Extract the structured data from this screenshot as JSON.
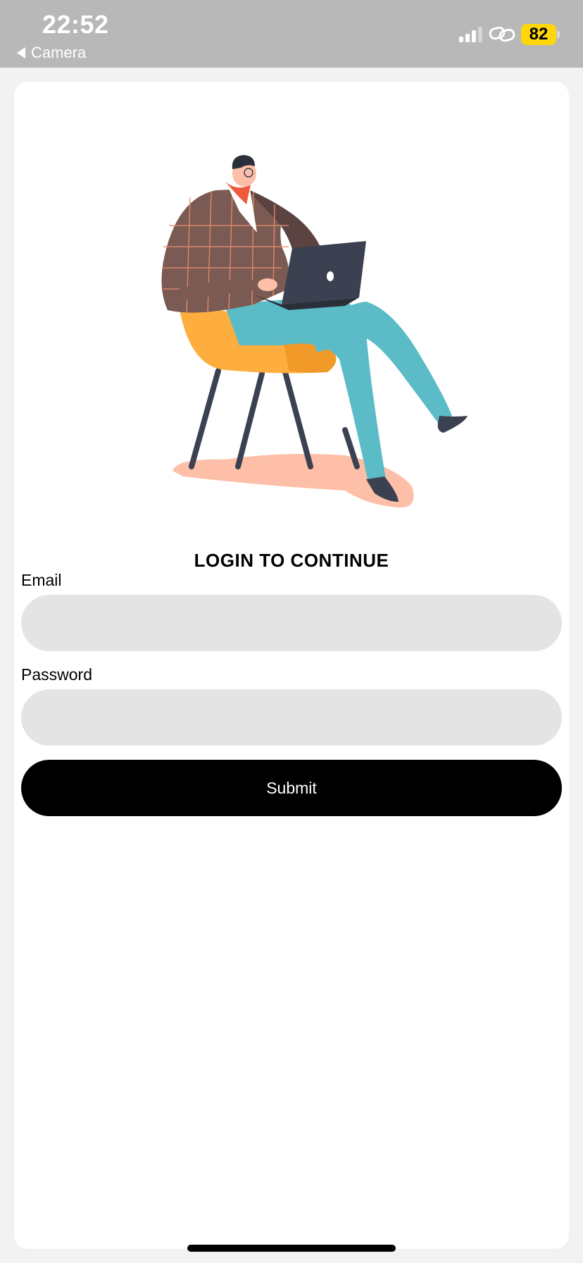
{
  "status_bar": {
    "time": "22:52",
    "back_label": "Camera",
    "battery_level": "82",
    "signal_bars_active": 3,
    "icons": [
      "signal-icon",
      "link-icon",
      "battery-icon"
    ]
  },
  "login": {
    "title": "LOGIN TO CONTINUE",
    "email_label": "Email",
    "email_value": "",
    "password_label": "Password",
    "password_value": "",
    "submit_label": "Submit"
  },
  "colors": {
    "status_bar_bg": "#b8b8b8",
    "battery": "#ffd60a",
    "input_bg": "#e4e4e4",
    "button_bg": "#000000"
  }
}
